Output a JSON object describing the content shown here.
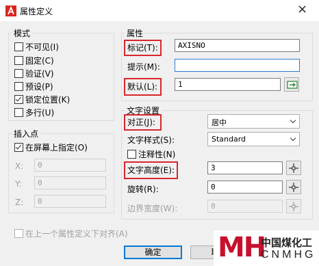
{
  "window": {
    "title": "属性定义",
    "close_icon": "×"
  },
  "mode_group": {
    "title": "模式",
    "items": [
      {
        "label": "不可见(I)",
        "checked": false
      },
      {
        "label": "固定(C)",
        "checked": false
      },
      {
        "label": "验证(V)",
        "checked": false
      },
      {
        "label": "预设(P)",
        "checked": false
      },
      {
        "label": "锁定位置(K)",
        "checked": true
      },
      {
        "label": "多行(U)",
        "checked": false
      }
    ]
  },
  "insert_group": {
    "title": "插入点",
    "on_screen_label": "在屏幕上指定(O)",
    "on_screen_checked": true,
    "x_label": "X:",
    "x_value": "0",
    "y_label": "Y:",
    "y_value": "0",
    "z_label": "Z:",
    "z_value": "0"
  },
  "attribute_group": {
    "title": "属性",
    "tag_label": "标记(T):",
    "tag_value": "AXISNO",
    "prompt_label": "提示(M):",
    "prompt_value": "",
    "default_label": "默认(L):",
    "default_value": "1"
  },
  "text_group": {
    "title": "文字设置",
    "justify_label": "对正(J):",
    "justify_value": "居中",
    "style_label": "文字样式(S):",
    "style_value": "Standard",
    "annotative_label": "注释性(N)",
    "annotative_checked": false,
    "height_label": "文字高度(E):",
    "height_value": "3",
    "rotation_label": "旋转(R):",
    "rotation_value": "0",
    "boundary_label": "边界宽度(W):",
    "boundary_value": "0"
  },
  "align_below_label": "在上一个属性定义下对齐(A)",
  "buttons": {
    "ok": "确定",
    "cancel": "取消"
  },
  "watermark": {
    "logo_text": "MH",
    "cn": "中国煤化工",
    "en": "CNMHG"
  },
  "colors": {
    "highlight": "#d9262b",
    "focus": "#2f7bd6",
    "logo_red": "#c8102e"
  }
}
